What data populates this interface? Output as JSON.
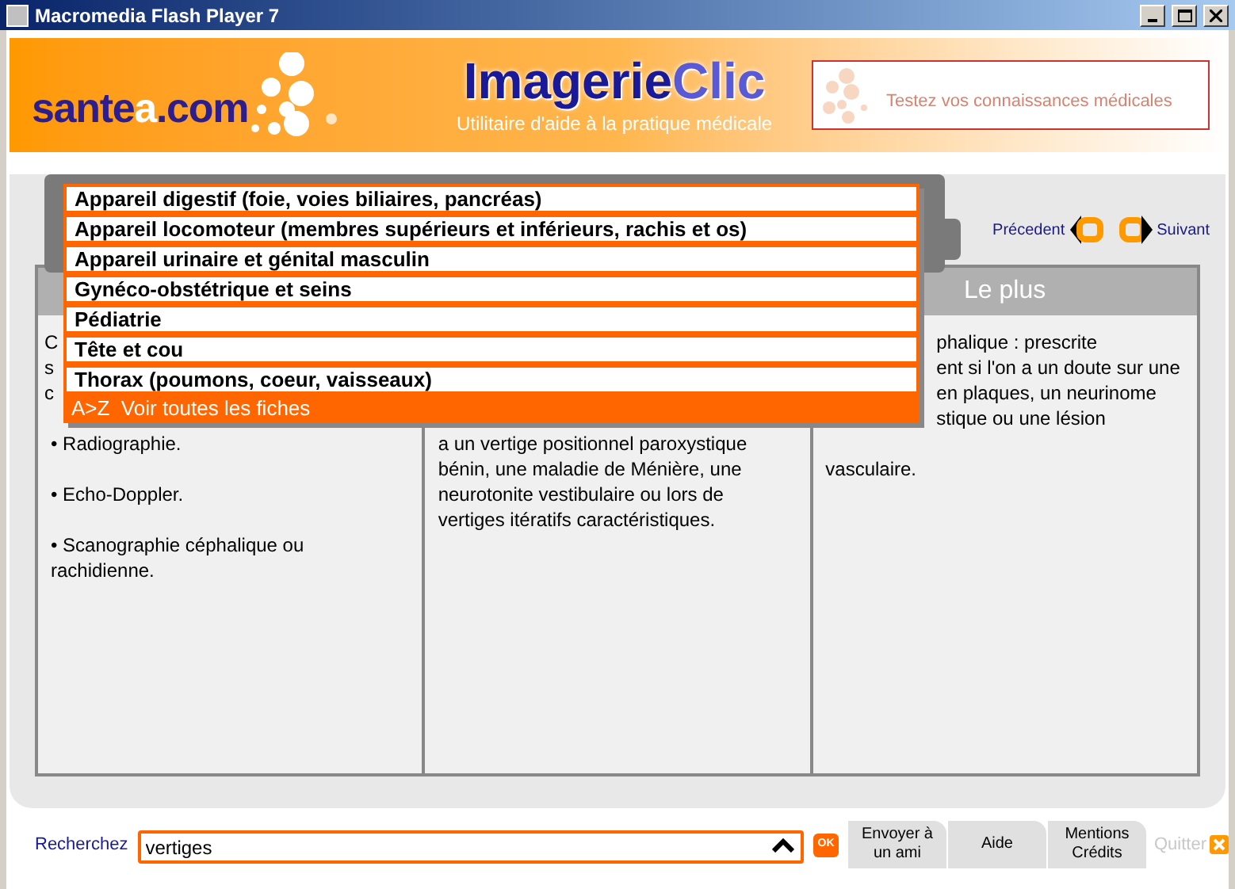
{
  "window": {
    "title": "Macromedia Flash Player 7"
  },
  "banner": {
    "site_logo": "sante",
    "site_logo_accent": "a",
    "site_logo_suffix": ".com",
    "app_title": "Imagerie",
    "app_title_accent": "Clic",
    "tagline": "Utilitaire d'aide à la pratique médicale",
    "quiz_link": "Testez vos connaissances médicales"
  },
  "navigation": {
    "previous": "Précedent",
    "next": "Suivant"
  },
  "columns": [
    {
      "lines": [
        {
          "kind": "edge",
          "text": "C"
        },
        {
          "kind": "edge",
          "text": "s"
        },
        {
          "kind": "edge",
          "text": "c"
        },
        {
          "kind": "gap"
        },
        {
          "kind": "text",
          "text": "• Radiographie."
        },
        {
          "kind": "gap"
        },
        {
          "kind": "text",
          "text": "• Echo-Doppler."
        },
        {
          "kind": "gap"
        },
        {
          "kind": "text",
          "text": "• Scanographie céphalique ou"
        },
        {
          "kind": "text",
          "text": "rachidienne."
        }
      ]
    },
    {
      "lines": [
        {
          "kind": "gap"
        },
        {
          "kind": "gap"
        },
        {
          "kind": "gap"
        },
        {
          "kind": "gap"
        },
        {
          "kind": "text",
          "text": "a un vertige positionnel paroxystique"
        },
        {
          "kind": "text",
          "text": "bénin, une maladie de Ménière, une"
        },
        {
          "kind": "text",
          "text": "neurotonite vestibulaire ou lors de"
        },
        {
          "kind": "text",
          "text": "vertiges itératifs caractéristiques."
        }
      ]
    },
    {
      "header": "Le plus",
      "lines": [
        {
          "kind": "fragment",
          "text": "phalique : prescrite"
        },
        {
          "kind": "fragment",
          "text": "ent si l'on a un doute sur une"
        },
        {
          "kind": "fragment",
          "text": "en plaques, un neurinome"
        },
        {
          "kind": "fragment",
          "text": "stique ou une lésion"
        },
        {
          "kind": "gap"
        },
        {
          "kind": "text",
          "text": "vasculaire."
        }
      ]
    }
  ],
  "category_menu": {
    "items": [
      {
        "label": "Appareil digestif (foie, voies biliaires, pancréas)",
        "kind": "category"
      },
      {
        "label": "Appareil locomoteur (membres supérieurs et inférieurs, rachis et os)",
        "kind": "category"
      },
      {
        "label": "Appareil urinaire et génital masculin",
        "kind": "category"
      },
      {
        "label": "Gynéco-obstétrique et seins",
        "kind": "category"
      },
      {
        "label": "Pédiatrie",
        "kind": "category"
      },
      {
        "label": "Tête et cou",
        "kind": "category"
      },
      {
        "label": "Thorax (poumons, coeur, vaisseaux)",
        "kind": "category"
      },
      {
        "label": "A>Z  Voir toutes les fiches",
        "kind": "all"
      }
    ]
  },
  "search": {
    "label": "Recherchez",
    "value": "vertiges",
    "ok": "OK"
  },
  "footer_tabs": [
    {
      "label": "Envoyer à\nun ami"
    },
    {
      "label": "Aide"
    },
    {
      "label": "Mentions\nCrédits"
    }
  ],
  "quit": {
    "label": "Quitter"
  }
}
